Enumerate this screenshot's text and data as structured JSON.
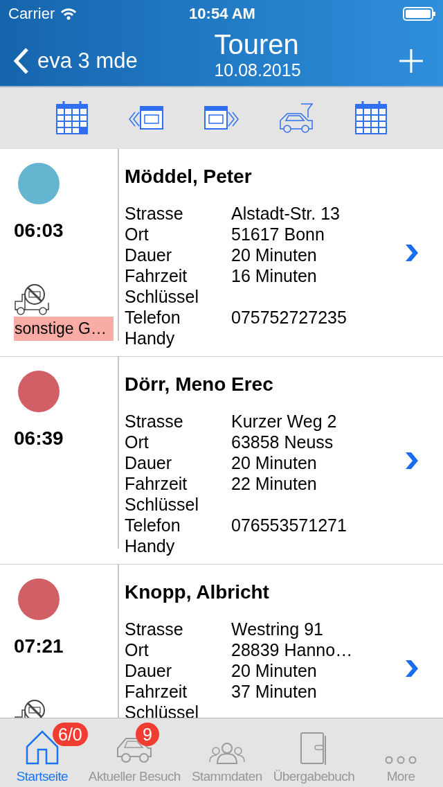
{
  "status_bar": {
    "carrier": "Carrier",
    "time": "10:54 AM"
  },
  "nav_bar": {
    "back_label": "eva 3 mde",
    "title": "Touren",
    "subtitle": "10.08.2015"
  },
  "tours": [
    {
      "name": "Möddel, Peter",
      "time": "06:03",
      "color": "#66b5d0",
      "vehicle_icon": true,
      "tag": "sonstige G…",
      "fields": [
        {
          "label": "Strasse",
          "value": "Alstadt-Str. 13"
        },
        {
          "label": "Ort",
          "value": "51617 Bonn"
        },
        {
          "label": "Dauer",
          "value": "20 Minuten"
        },
        {
          "label": "Fahrzeit",
          "value": "16 Minuten"
        },
        {
          "label": "Schlüssel"
        },
        {
          "label": "Telefon",
          "value": "075752727235"
        },
        {
          "label": "Handy"
        }
      ]
    },
    {
      "name": "Dörr, Meno Erec",
      "time": "06:39",
      "color": "#d06065",
      "vehicle_icon": false,
      "fields": [
        {
          "label": "Strasse",
          "value": "Kurzer Weg 2"
        },
        {
          "label": "Ort",
          "value": "63858 Neuss"
        },
        {
          "label": "Dauer",
          "value": "20 Minuten"
        },
        {
          "label": "Fahrzeit",
          "value": "22 Minuten"
        },
        {
          "label": "Schlüssel"
        },
        {
          "label": "Telefon",
          "value": "076553571271"
        },
        {
          "label": "Handy"
        }
      ]
    },
    {
      "name": "Knopp, Albricht",
      "time": "07:21",
      "color": "#d06065",
      "vehicle_icon": true,
      "fields": [
        {
          "label": "Strasse",
          "value": "Westring 91"
        },
        {
          "label": "Ort",
          "value": "28839 Hanno…"
        },
        {
          "label": "Dauer",
          "value": "20 Minuten"
        },
        {
          "label": "Fahrzeit",
          "value": "37 Minuten"
        },
        {
          "label": "Schlüssel"
        }
      ]
    }
  ],
  "tab_bar": [
    {
      "label": "Startseite",
      "selected": true,
      "badge": "6/0"
    },
    {
      "label": "Aktueller Besuch",
      "selected": false,
      "badge": "9"
    },
    {
      "label": "Stammdaten",
      "selected": false
    },
    {
      "label": "Übergabebuch",
      "selected": false
    },
    {
      "label": "More",
      "selected": false
    }
  ]
}
